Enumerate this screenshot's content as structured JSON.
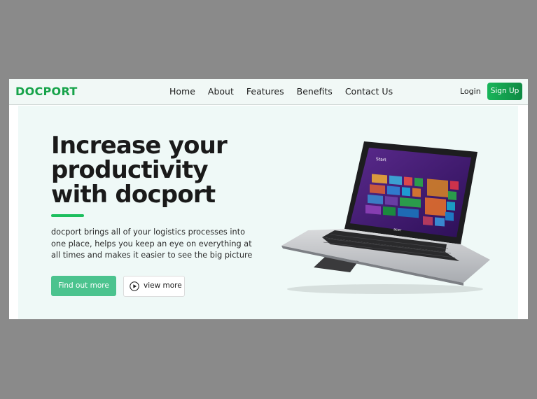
{
  "nav": {
    "logo": "DOCPORT",
    "links": [
      "Home",
      "About",
      "Features",
      "Benefits",
      "Contact Us"
    ],
    "login": "Login",
    "signup": "Sign Up"
  },
  "hero": {
    "headline": "Increase your productivity with docport",
    "description": "docport brings all of your logistics processes into one place, helps you keep an eye on everything at all times and makes it easier to see the big picture",
    "primary_button": "Find out more",
    "secondary_button": "view more",
    "laptop_screen_label": "Start",
    "laptop_brand": "acer"
  },
  "colors": {
    "brand": "#17a34a",
    "accent": "#1cbf5e",
    "primary_button": "#4bc38e",
    "hero_bg": "#eff9f7"
  },
  "icons": {
    "play": "play-circle-icon"
  }
}
